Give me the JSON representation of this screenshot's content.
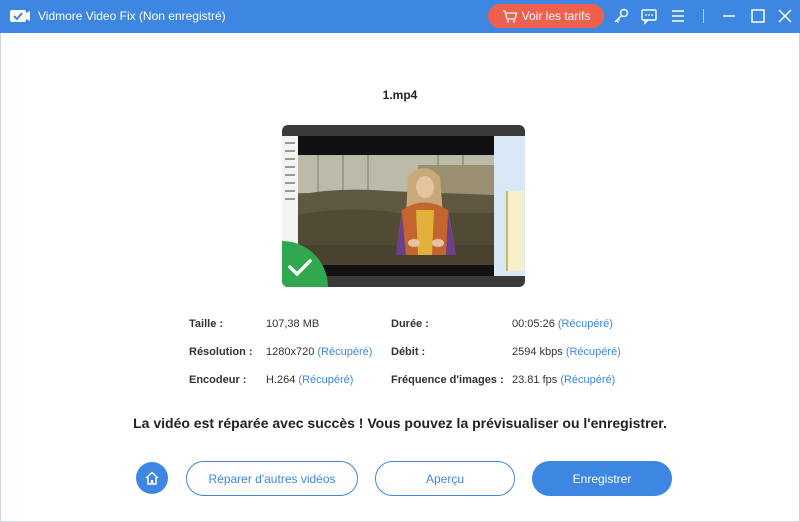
{
  "app": {
    "title": "Vidmore Video Fix (Non enregistré)",
    "pricing_label": "Voir les tarifs",
    "accent_color": "#3d86e2",
    "pricing_color": "#f0604e"
  },
  "titlebar_icons": [
    "cart-icon",
    "key-icon",
    "feedback-icon",
    "menu-icon",
    "minimize-icon",
    "maximize-icon",
    "close-icon"
  ],
  "file": {
    "name": "1.mp4"
  },
  "info": {
    "size_label": "Taille :",
    "size_value": "107,38 MB",
    "resolution_label": "Résolution :",
    "resolution_value": "1280x720",
    "resolution_tag": "(Récupéré)",
    "encoder_label": "Encodeur :",
    "encoder_value": "H.264",
    "encoder_tag": "(Récupéré)",
    "duration_label": "Durée :",
    "duration_value": "00:05:26",
    "duration_tag": "(Récupéré)",
    "bitrate_label": "Débit :",
    "bitrate_value": "2594 kbps",
    "bitrate_tag": "(Récupéré)",
    "framerate_label": "Fréquence d'images :",
    "framerate_value": "23.81 fps",
    "framerate_tag": "(Récupéré)"
  },
  "status_message": "La vidéo est réparée avec succès ! Vous pouvez la prévisualiser ou l'enregistrer.",
  "buttons": {
    "repair_other": "Réparer d'autres vidéos",
    "preview": "Aperçu",
    "save": "Enregistrer"
  }
}
